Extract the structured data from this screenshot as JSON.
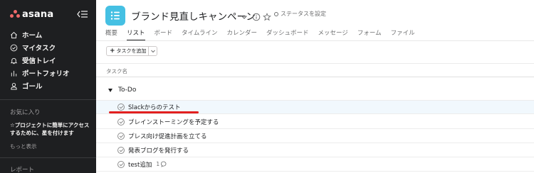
{
  "sidebar": {
    "logo_text": "asana",
    "nav": [
      {
        "label": "ホーム",
        "icon": "home-icon"
      },
      {
        "label": "マイタスク",
        "icon": "check-circle-icon"
      },
      {
        "label": "受信トレイ",
        "icon": "bell-icon"
      },
      {
        "label": "ポートフォリオ",
        "icon": "bar-chart-icon"
      },
      {
        "label": "ゴール",
        "icon": "person-icon"
      }
    ],
    "favorites_title": "お気に入り",
    "favorites_hint": "☆プロジェクトに簡単にアクセスするために、星を付けます",
    "more_link": "もっと表示",
    "reports_title": "レポート"
  },
  "header": {
    "project_title": "ブランド見直しキャンペーン",
    "status": "ステータスを設定",
    "tabs": [
      "概要",
      "リスト",
      "ボード",
      "タイムライン",
      "カレンダー",
      "ダッシュボード",
      "メッセージ",
      "フォーム",
      "ファイル"
    ],
    "active_tab": "リスト"
  },
  "toolbar": {
    "add_task": "タスクを追加"
  },
  "list": {
    "column_header": "タスク名",
    "section_title": "To-Do",
    "tasks": [
      {
        "name": "Slackからのテスト"
      },
      {
        "name": "ブレインストーミングを予定する"
      },
      {
        "name": "プレス向け促進計画を立てる"
      },
      {
        "name": "発表ブログを発行する"
      },
      {
        "name": "test追加",
        "comments": "1"
      }
    ]
  },
  "colors": {
    "sidebar_bg": "#1e1f21",
    "accent_logo": "#f06a6a",
    "project_icon": "#45c0e3",
    "highlight_row": "#f1f8fd",
    "annotation_red": "#e21f1f"
  }
}
